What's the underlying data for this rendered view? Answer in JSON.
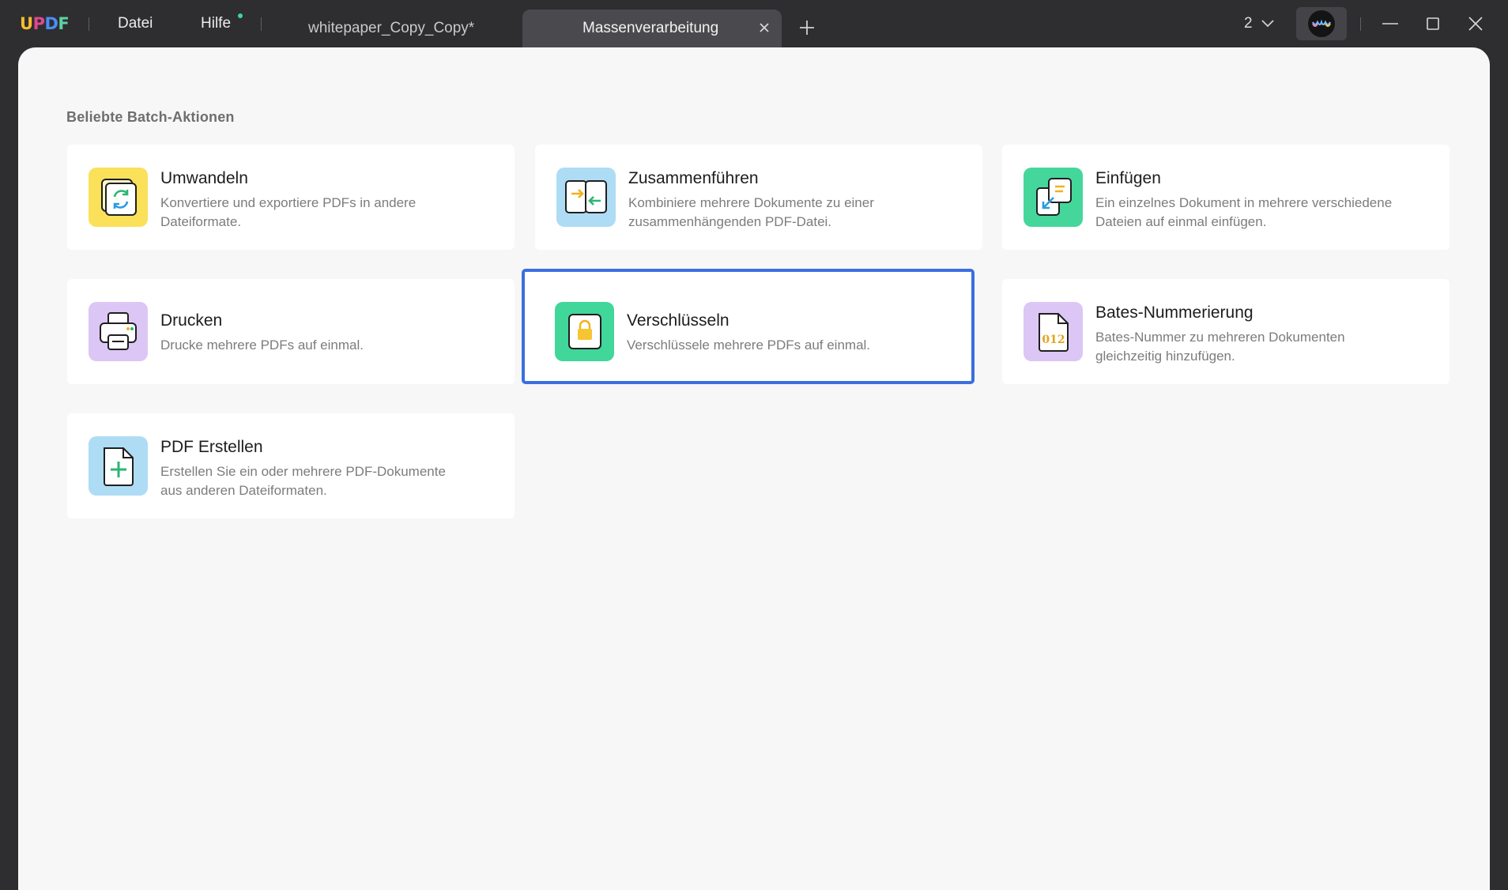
{
  "app": {
    "logo": {
      "u": "U",
      "p": "P",
      "d": "D",
      "f": "F"
    },
    "menu": {
      "file": "Datei",
      "help": "Hilfe"
    },
    "tabs": [
      {
        "label": "whitepaper_Copy_Copy*",
        "active": false
      },
      {
        "label": "Massenverarbeitung",
        "active": true
      }
    ],
    "page_count": "2",
    "colors": {
      "titlebar": "#2e2e31",
      "content_bg": "#f7f7f7",
      "selection_border": "#3b6fe0",
      "notification_dot": "#3ed6a4"
    }
  },
  "main": {
    "section_title": "Beliebte Batch-Aktionen",
    "cards": [
      {
        "id": "convert",
        "title": "Umwandeln",
        "desc_line1": "Konvertiere und exportiere PDFs in andere",
        "desc_line2": "Dateiformate.",
        "icon": "convert-icon",
        "icon_bg": "#fbe05a"
      },
      {
        "id": "merge",
        "title": "Zusammenführen",
        "desc_line1": "Kombiniere mehrere Dokumente zu einer",
        "desc_line2": "zusammenhängenden PDF-Datei.",
        "icon": "merge-icon",
        "icon_bg": "#aedcf5"
      },
      {
        "id": "insert",
        "title": "Einfügen",
        "desc_line1": "Ein einzelnes Dokument in mehrere verschiedene",
        "desc_line2": "Dateien auf einmal einfügen.",
        "icon": "insert-icon",
        "icon_bg": "#45d69c"
      },
      {
        "id": "print",
        "title": "Drucken",
        "desc_line1": "Drucke mehrere PDFs auf einmal.",
        "desc_line2": "",
        "icon": "printer-icon",
        "icon_bg": "#dcc6f5"
      },
      {
        "id": "encrypt",
        "title": "Verschlüsseln",
        "desc_line1": "Verschlüssele mehrere PDFs auf einmal.",
        "desc_line2": "",
        "icon": "lock-icon",
        "icon_bg": "#41d69a",
        "selected": true
      },
      {
        "id": "bates",
        "title": "Bates-Nummerierung",
        "desc_line1": "Bates-Nummer zu mehreren Dokumenten",
        "desc_line2": "gleichzeitig hinzufügen.",
        "icon": "bates-number-icon",
        "icon_bg": "#dcc6f5"
      },
      {
        "id": "create",
        "title": "PDF Erstellen",
        "desc_line1": "Erstellen Sie ein oder mehrere PDF-Dokumente",
        "desc_line2": "aus anderen Dateiformaten.",
        "icon": "create-pdf-icon",
        "icon_bg": "#aedcf5"
      }
    ]
  }
}
